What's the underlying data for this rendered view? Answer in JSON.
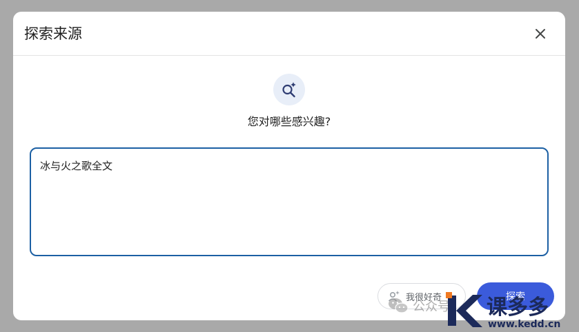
{
  "dialog": {
    "title": "探索来源",
    "prompt": "您对哪些感兴趣?",
    "input_value": "冰与火之歌全文",
    "curious_button": "我很好奇",
    "submit_button": "探索"
  },
  "watermark": {
    "wechat_text": "公众号",
    "site_name": "课多多",
    "site_url": "www.kedd.cn"
  },
  "colors": {
    "accent": "#3b5bdb",
    "input_border": "#1b5fa3",
    "icon_bg": "#e8eef8",
    "logo_orange": "#f07a22",
    "logo_dark": "#1c2a5a"
  },
  "icons": {
    "close": "close-icon",
    "explore": "search-sparkle-icon",
    "curious": "sparkle-person-icon",
    "wechat": "wechat-icon"
  }
}
